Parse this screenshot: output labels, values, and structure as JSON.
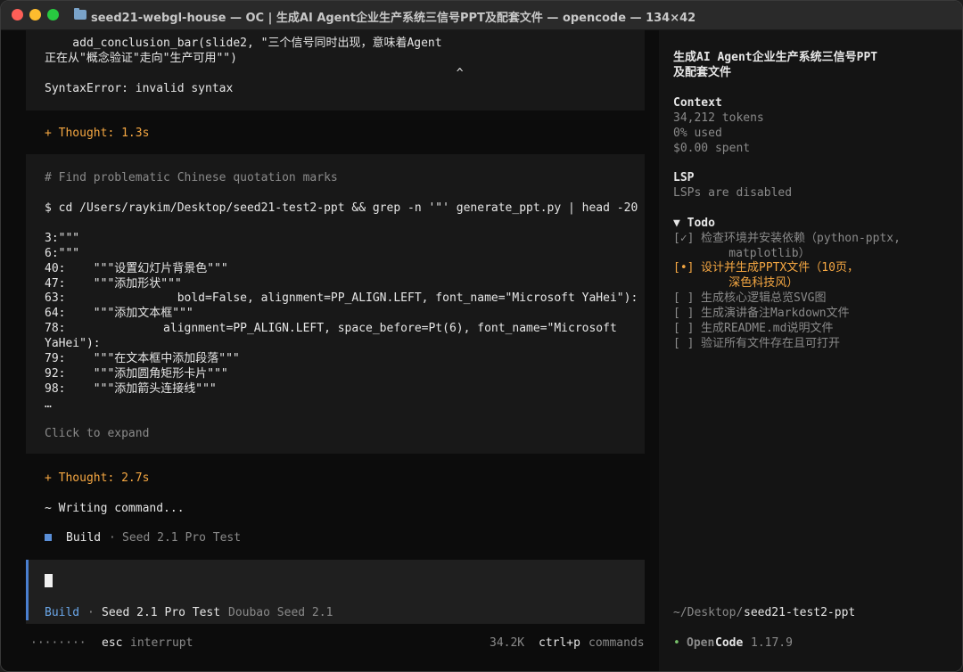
{
  "window": {
    "title": "seed21-webgl-house — OC | 生成AI Agent企业生产系统三信号PPT及配套文件 — opencode — 134×42"
  },
  "error_block": {
    "lines": [
      "    add_conclusion_bar(slide2, \"三个信号同时出现，意味着Agent",
      "正在从\"概念验证\"走向\"生产可用\"\")",
      "                                                           ^",
      "SyntaxError: invalid syntax"
    ]
  },
  "thought1": "+ Thought: 1.3s",
  "tool_block": {
    "comment": "# Find problematic Chinese quotation marks",
    "command": "$ cd /Users/raykim/Desktop/seed21-test2-ppt && grep -n '\"' generate_ppt.py | head -20",
    "output": [
      "3:\"\"\"",
      "6:\"\"\"",
      "40:    \"\"\"设置幻灯片背景色\"\"\"",
      "47:    \"\"\"添加形状\"\"\"",
      "63:                bold=False, alignment=PP_ALIGN.LEFT, font_name=\"Microsoft YaHei\"):",
      "64:    \"\"\"添加文本框\"\"\"",
      "78:              alignment=PP_ALIGN.LEFT, space_before=Pt(6), font_name=\"Microsoft",
      "YaHei\"):",
      "79:    \"\"\"在文本框中添加段落\"\"\"",
      "92:    \"\"\"添加圆角矩形卡片\"\"\"",
      "98:    \"\"\"添加箭头连接线\"\"\"",
      "…"
    ],
    "expand_label": "Click to expand"
  },
  "thought2": "+ Thought: 2.7s",
  "writing": "~ Writing command...",
  "build_status": {
    "icon": "build-square-icon",
    "label": "Build",
    "sep": "·",
    "model": "Seed 2.1 Pro Test"
  },
  "prompt": {
    "mode": "Build",
    "sep": "·",
    "model": "Seed 2.1 Pro Test",
    "provider": "Doubao Seed 2.1"
  },
  "footer": {
    "dots": "········",
    "esc_key": "esc",
    "esc_label": "interrupt",
    "tokens": "34.2K",
    "cmd_key": "ctrl+p",
    "cmd_label": "commands"
  },
  "sidebar": {
    "title": "生成AI Agent企业生产系统三信号PPT\n及配套文件",
    "context_heading": "Context",
    "context_lines": [
      "34,212 tokens",
      "0% used",
      "$0.00 spent"
    ],
    "lsp_heading": "LSP",
    "lsp_text": "LSPs are disabled",
    "todo_heading": "▼ Todo",
    "todos": [
      {
        "mark": "[✓]",
        "text": "检查环境并安装依赖（python-pptx,\n    matplotlib）",
        "state": "done"
      },
      {
        "mark": "[•]",
        "text": "设计并生成PPTX文件（10页，\n    深色科技风）",
        "state": "active"
      },
      {
        "mark": "[ ]",
        "text": "生成核心逻辑总览SVG图",
        "state": "pending"
      },
      {
        "mark": "[ ]",
        "text": "生成演讲备注Markdown文件",
        "state": "pending"
      },
      {
        "mark": "[ ]",
        "text": "生成README.md说明文件",
        "state": "pending"
      },
      {
        "mark": "[ ]",
        "text": "验证所有文件存在且可打开",
        "state": "pending"
      }
    ],
    "path_prefix": "~/Desktop/",
    "path_name": "seed21-test2-ppt",
    "brand_dot": "•",
    "brand_open": "Open",
    "brand_code": "Code",
    "version": "1.17.9"
  },
  "colors": {
    "accent_orange": "#f5a742",
    "accent_blue": "#6aa6e8",
    "brand_green": "#78c26b"
  }
}
